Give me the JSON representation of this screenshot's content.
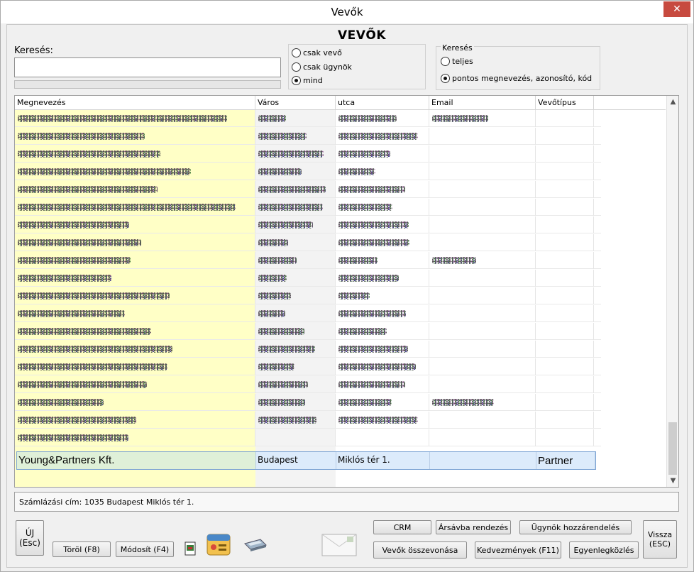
{
  "window": {
    "title": "Vevők",
    "close_glyph": "✕"
  },
  "heading": "VEVŐK",
  "search": {
    "label": "Keresés:",
    "value": "",
    "placeholder": ""
  },
  "filter_group": {
    "options": [
      "csak vevő",
      "csak ügynök",
      "mind"
    ],
    "selected": 2
  },
  "search_mode": {
    "title": "Keresés",
    "options": [
      "teljes",
      "pontos megnevezés, azonosító, kód"
    ],
    "selected": 1
  },
  "grid": {
    "columns": [
      "Megnevezés",
      "Város",
      "utca",
      "Email",
      "Vevőtípus"
    ],
    "redacted_rows": 19,
    "selected_row": {
      "name": "Young&Partners Kft.",
      "city": "Budapest",
      "street": "Miklós tér 1.",
      "email": "",
      "type": "Partner"
    }
  },
  "address": "Számlázási cím: 1035 Budapest Miklós tér 1.",
  "buttons": {
    "new": "ÚJ\n(Esc)",
    "delete": "Töröl (F8)",
    "modify": "Módosít (F4)",
    "crm": "CRM",
    "price_sort": "Ársávba rendezés",
    "agent_assign": "Ügynök hozzárendelés",
    "merge": "Vevők összevonása",
    "discounts": "Kedvezmények (F11)",
    "balance": "Egyenlegközlés",
    "back": "Vissza\n(ESC)"
  },
  "icons": [
    "document-icon",
    "calendar-icon",
    "scanner-icon",
    "envelope-icon"
  ],
  "colors": {
    "name_col": "#ffffc6",
    "city_col": "#f3f3f3",
    "selected_name": "#dff0d8",
    "selected_other": "#dcebfb",
    "close": "#c74a3f"
  }
}
